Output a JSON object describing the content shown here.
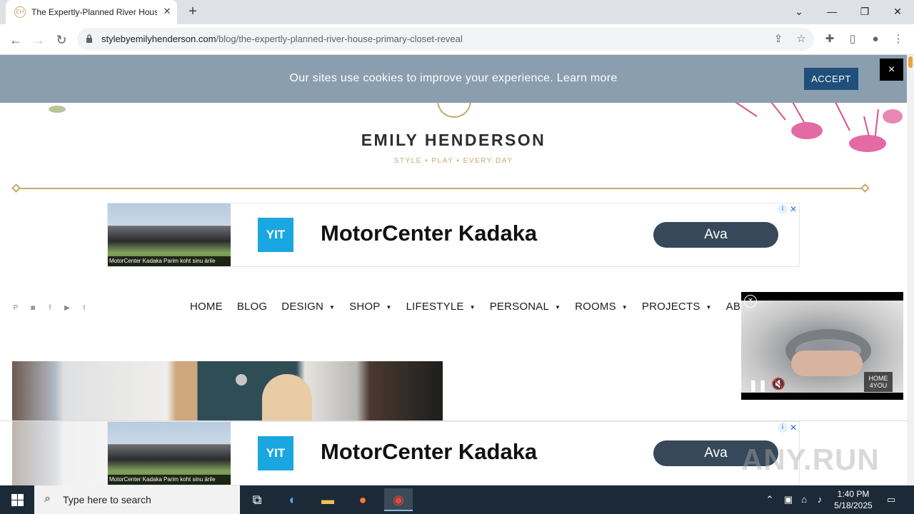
{
  "browser": {
    "tab_title": "The Expertly-Planned River House",
    "new_tab_icon": "plus-icon",
    "url_domain": "stylebyemilyhenderson.com",
    "url_path": "/blog/the-expertly-planned-river-house-primary-closet-reveal"
  },
  "cookie_banner": {
    "message": "Our sites use cookies to improve your experience. Learn more",
    "accept_label": "ACCEPT",
    "close_label": "×"
  },
  "site": {
    "logo_name": "EMILY HENDERSON",
    "logo_tagline": "STYLE   •   PLAY   •   EVERY DAY"
  },
  "ad": {
    "caption": "MotorCenter Kadaka Parim koht sinu ärile",
    "brand": "YIT",
    "headline": "MotorCenter Kadaka",
    "cta": "Ava",
    "info_label": "i",
    "close_label": "✕"
  },
  "nav": {
    "items": [
      {
        "label": "HOME",
        "caret": ""
      },
      {
        "label": "BLOG",
        "caret": ""
      },
      {
        "label": "DESIGN",
        "caret": "▼"
      },
      {
        "label": "SHOP",
        "caret": "▼"
      },
      {
        "label": "LIFESTYLE",
        "caret": "▼"
      },
      {
        "label": "PERSONAL",
        "caret": "▼"
      },
      {
        "label": "ROOMS",
        "caret": "▼"
      },
      {
        "label": "PROJECTS",
        "caret": "▼"
      },
      {
        "label": "AB",
        "caret": ""
      }
    ]
  },
  "video": {
    "brand_label_line1": "HOME",
    "brand_label_line2": "4YOU"
  },
  "watermark": "ANY.RUN",
  "taskbar": {
    "search_placeholder": "Type here to search",
    "time": "1:40 PM",
    "date": "5/18/2025"
  }
}
